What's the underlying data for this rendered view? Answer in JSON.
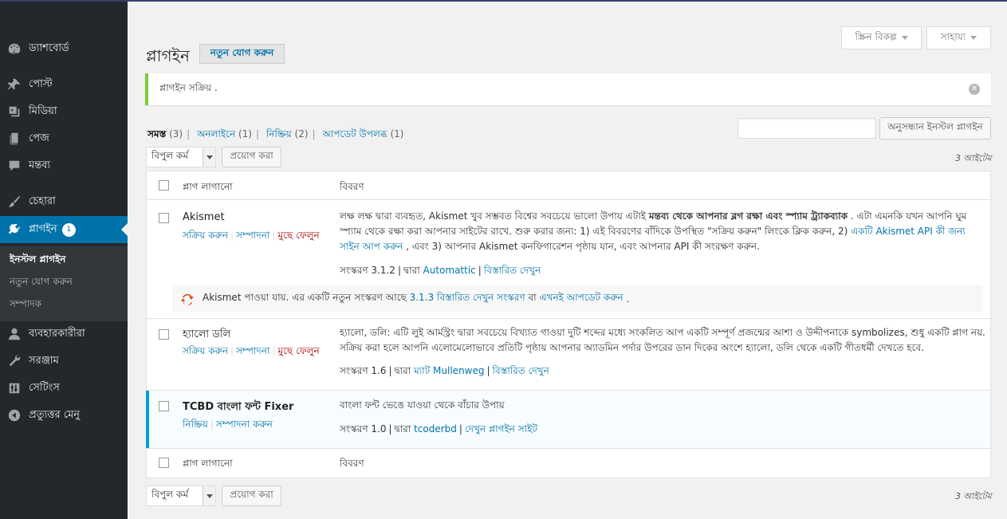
{
  "sidebar": {
    "items": [
      {
        "label": "ড্যাশবোর্ড",
        "icon": "dashboard-icon"
      },
      {
        "label": "পোস্ট",
        "icon": "pin-icon"
      },
      {
        "label": "মিডিয়া",
        "icon": "media-icon"
      },
      {
        "label": "পেজ",
        "icon": "page-icon"
      },
      {
        "label": "মন্তব্য",
        "icon": "comment-icon"
      },
      {
        "label": "চেহারা",
        "icon": "brush-icon"
      },
      {
        "label": "প্লাগইন",
        "icon": "plugin-icon",
        "badge": "1"
      },
      {
        "label": "ব্যবহারকারীরা",
        "icon": "user-icon"
      },
      {
        "label": "সরঞ্জাম",
        "icon": "wrench-icon"
      },
      {
        "label": "সেটিংস",
        "icon": "settings-icon"
      },
      {
        "label": "প্রত্যুত্তর মেনু",
        "icon": "collapse-icon"
      }
    ],
    "submenu": [
      "ইনস্টল প্লাগইন",
      "নতুন যোগ করুন",
      "সম্পাদক"
    ]
  },
  "top_buttons": {
    "screen_options": "স্ক্রিন বিকল্প",
    "help": "সাহায্য"
  },
  "header": {
    "title": "প্লাগইন",
    "add_new": "নতুন যোগ করুন"
  },
  "notice": {
    "message": "প্লাগইন সক্রিয় ."
  },
  "filters": {
    "all": "সমস্ত",
    "all_count": "(3)",
    "active": "অনলাইনে",
    "active_count": "(1)",
    "inactive": "নিষ্ক্রিয়",
    "inactive_count": "(2)",
    "update": "আপডেট উপলব্ধ",
    "update_count": "(1)"
  },
  "search": {
    "button": "অনুসন্ধান ইনস্টল প্লাগইন"
  },
  "bulk": {
    "select": "বিপুল কর্ম",
    "apply": "প্রয়োগ করা",
    "count": "3 আইটেম"
  },
  "table": {
    "col_plugin": "প্লাগ লাগানো",
    "col_desc": "বিবরণ",
    "plugins": [
      {
        "name": "Akismet",
        "actions": [
          "সক্রিয় করুন",
          "সম্পাদনা",
          "মুছে ফেলুন"
        ],
        "desc_part1": "লক্ষ লক্ষ দ্বারা ব্যবহৃত, Akismet খুব সম্ভবত বিশ্বের সবচেয়ে ভালো উপায় এটাই",
        "desc_bold": "মন্তব্য থেকে আপনার ব্লগ রক্ষা এবং স্প্যাম ট্র্যাকব্যাক",
        "desc_part2": ". এটা এমনকি যখন আপনি ঘুম স্প্যাম থেকে রক্ষা করা আপনার সাইটের রাখে. শুরু করার জন্য: 1) এই বিবরণের বাঁদিকে উপস্থিত \"সক্রিয় করুন\" লিংকে ক্লিক করুন, 2)",
        "desc_link": "একটি Akismet API কী জন্য সাইন আপ করুন",
        "desc_part3": ", এবং 3) আপনার Akismet কনফিগারেশন পৃষ্ঠায় যান, এবং আপনার API কী সংরক্ষণ করুন.",
        "version": "সংস্করণ 3.1.2",
        "by": "দ্বারা",
        "author": "Automattic",
        "details": "বিস্তারিত দেখুন",
        "update_text1": "Akismet পাওয়া যায়. এর একটি নতুন সংস্করণ আছে",
        "update_link1": "3.1.3 বিস্তারিত দেখুন সংস্করণ",
        "update_text2": "বা",
        "update_link2": "এখনই আপডেট করুন",
        "update_text3": "."
      },
      {
        "name": "হ্যালো ডলি",
        "actions": [
          "সক্রিয় করুন",
          "সম্পাদনা",
          "মুছে ফেলুন"
        ],
        "desc_line1": "হ্যালো, ডলি: এটি লুই আর্মস্ট্রং দ্বারা সবচেয়ে বিখ্যাত গাওয়া দুটি শব্দের মধ্যে সংকলিত আপ একটি সম্পূর্ণ প্রজন্মের আশা ও উদ্দীপনাকে symbolizes, শুধু একটি প্লাগ নয়.",
        "desc_line2": "সক্রিয় করা হলে আপনি এলোমেলোভাবে প্রতিটি পৃষ্ঠায় আপনার অ্যাডমিন পর্দার উপরের ডান দিকের অংশে হ্যালো, ডলি থেকে একটি গীতধর্মী দেখতে হবে.",
        "version": "সংস্করণ 1.6",
        "by": "দ্বারা",
        "author": "ম্যাট Mullenweg",
        "details": "বিস্তারিত দেখুন"
      },
      {
        "name": "TCBD বাংলা ফন্ট Fixer",
        "actions": [
          "নিষ্ক্রিয়",
          "সম্পাদনা করুন"
        ],
        "desc_line1": "বাংলা ফন্ট ভেঙে যাওয়া থেকে বাঁচার উপায়",
        "version": "সংস্করণ 1.0",
        "by": "দ্বারা",
        "author": "tcoderbd",
        "details": "দেখুন প্লাগইন সাইট"
      }
    ]
  },
  "colors": {
    "sidebar_bg": "#23282d",
    "accent": "#0073aa",
    "notice_border": "#7ad03a",
    "delete": "#aa0000",
    "active_row_border": "#00a0d2"
  }
}
